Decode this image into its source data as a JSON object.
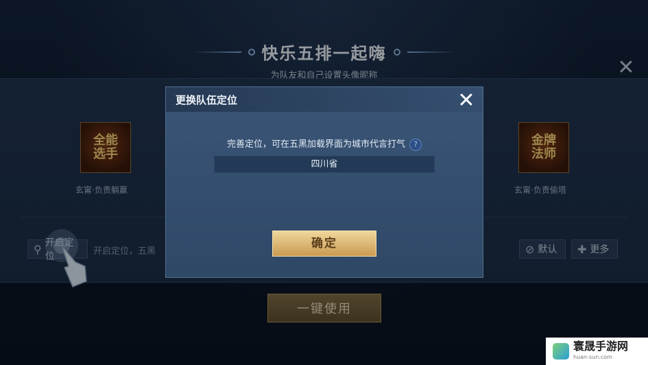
{
  "header": {
    "title": "快乐五排一起嗨",
    "subtitle": "为队友和自己设置头像昵称",
    "close_glyph": "✕"
  },
  "cards": [
    {
      "icon_line1": "全能",
      "icon_line2": "选手",
      "label": "玄甯·负责躺赢"
    },
    {
      "icon_line1": "金牌",
      "icon_line2": "法师",
      "label": "玄甯·负责偷塔"
    }
  ],
  "location": {
    "chip_label": "开启定位",
    "placeholder": "开启定位，五黑"
  },
  "right_chips": {
    "default_label": "默认",
    "more_label": "更多"
  },
  "use_button_label": "一键使用",
  "dialog": {
    "title": "更换队伍定位",
    "close_glyph": "✕",
    "description": "完善定位，可在五黑加载界面为城市代言打气",
    "help_glyph": "?",
    "province": "四川省",
    "confirm_label": "确定"
  },
  "watermark": {
    "name": "寰晟手游网",
    "url": "huan-sun.com"
  },
  "colors": {
    "accent_gold": "#e6c27a",
    "dialog_bg": "#344f70",
    "page_bg": "#0d1a2b"
  },
  "icons": [
    "location-pin-icon",
    "forbid-icon",
    "plus-icon",
    "close-icon",
    "help-icon",
    "hand-pointer-icon"
  ]
}
